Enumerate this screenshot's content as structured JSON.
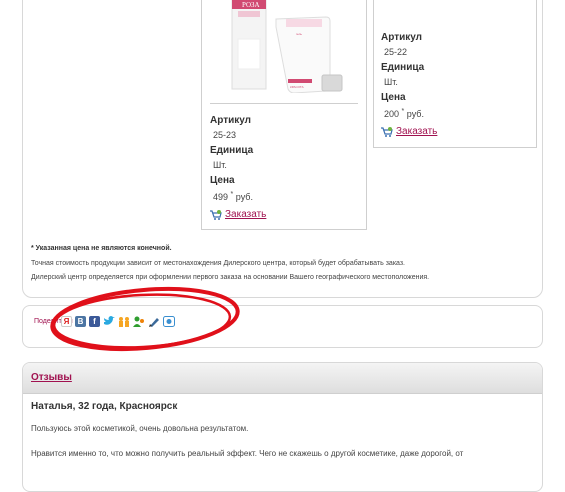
{
  "product_main": {
    "image_labels": [
      "РОЗА",
      "КРАСОТА"
    ],
    "article_label": "Артикул",
    "article_value": "25-23",
    "unit_label": "Единица",
    "unit_value": "Шт.",
    "price_label": "Цена",
    "price_value": "499",
    "price_mark": "*",
    "price_currency": "руб.",
    "order_label": "Заказать"
  },
  "product_side": {
    "article_label": "Артикул",
    "article_value": "25-22",
    "unit_label": "Единица",
    "unit_value": "Шт.",
    "price_label": "Цена",
    "price_value": "200",
    "price_mark": "*",
    "price_currency": "руб.",
    "order_label": "Заказать"
  },
  "notes": {
    "price_note": "* Указанная цена не являются конечной.",
    "line1": "Точная стоимость продукции зависит от местонахождения Дилерского центра, который будет обрабатывать заказ.",
    "line2": "Дилерский центр определяется при оформлении первого заказа на основании Вашего географического местоположения."
  },
  "share": {
    "label": "Поделиться",
    "icons": [
      "yandex-icon",
      "vkontakte-icon",
      "facebook-icon",
      "twitter-icon",
      "moimir-icon",
      "odnoklassniki-icon",
      "livejournal-icon",
      "liveinternet-icon"
    ],
    "annotation_color": "#e0101a"
  },
  "reviews": {
    "title": "Отзывы",
    "author": "Наталья, 32 года, Красноярск",
    "text1": "Пользуюсь этой косметикой, очень довольна результатом.",
    "text2": "Нравится именно то, что можно получить реальный эффект. Чего не скажешь о другой косметике, даже дорогой, от"
  },
  "colors": {
    "accent": "#a0114f",
    "border": "#d8d8d8"
  }
}
